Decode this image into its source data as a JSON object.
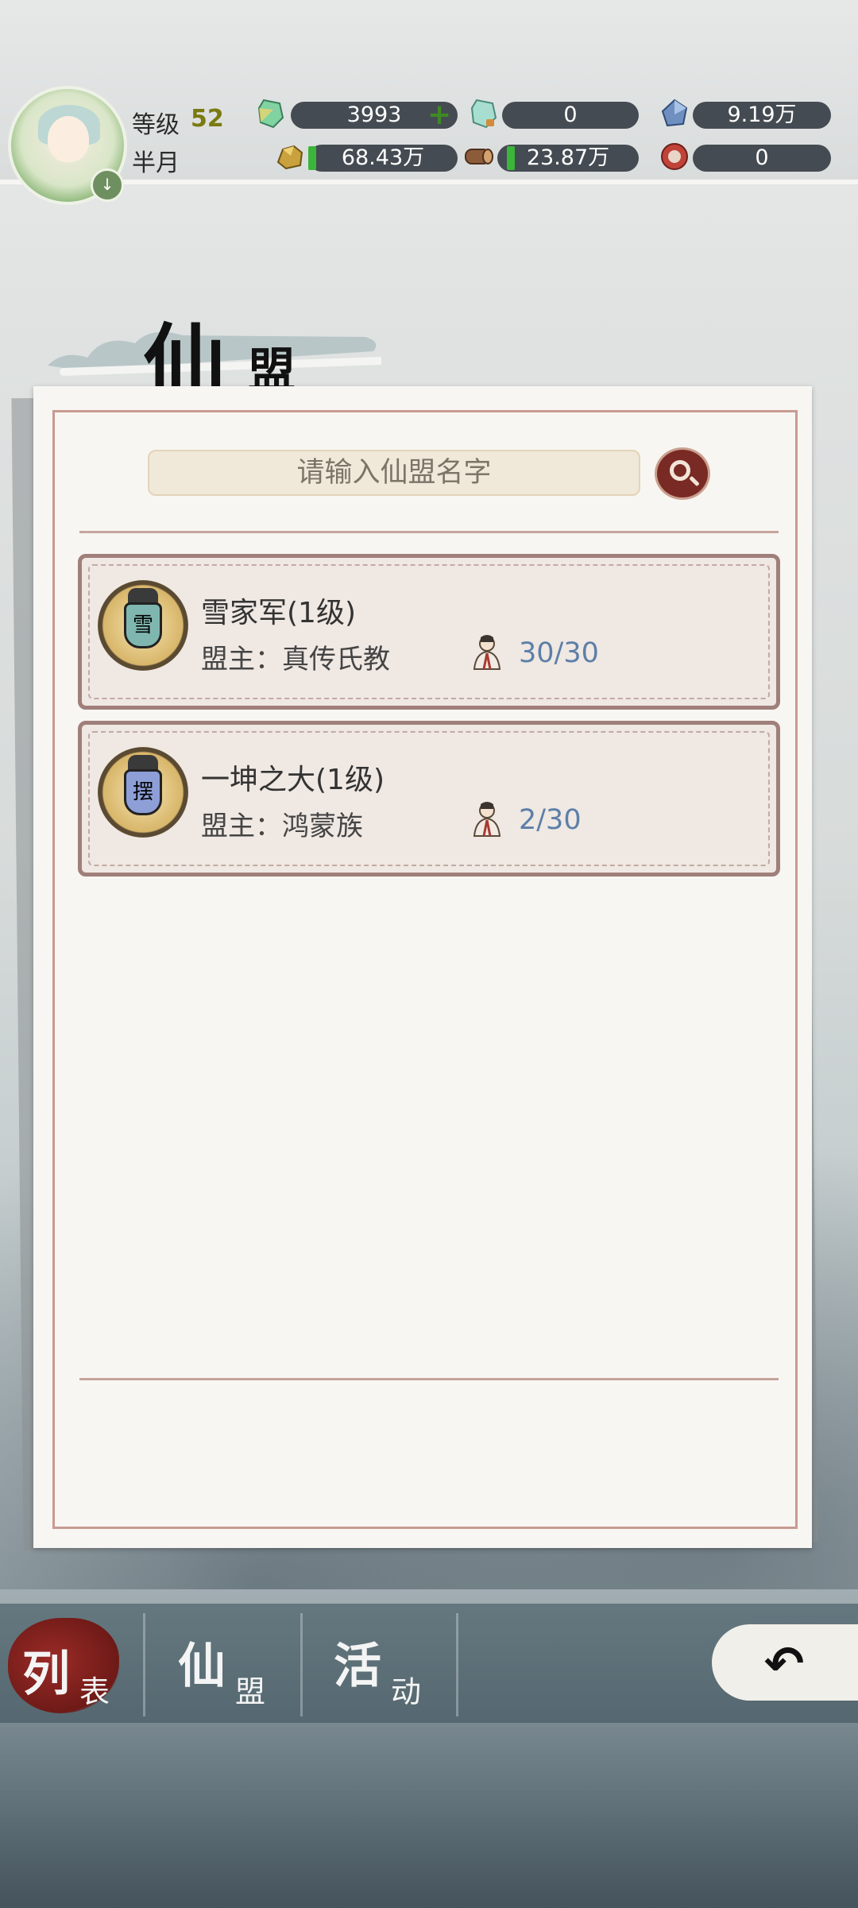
{
  "hud": {
    "level_label": "等级",
    "level_value": "52",
    "player_name": "半月",
    "avatar_badge": "↓",
    "resources": [
      {
        "name": "spirit-stone",
        "value": "3993",
        "has_plus": true
      },
      {
        "name": "bound-spirit-stone",
        "value": "0"
      },
      {
        "name": "blue-crystal",
        "value": "9.19万"
      },
      {
        "name": "gold-ore",
        "value": "68.43万"
      },
      {
        "name": "wood",
        "value": "23.87万"
      },
      {
        "name": "red-token",
        "value": "0"
      }
    ],
    "colors": {
      "bar": "#454b52",
      "plus": "#3e8a24"
    }
  },
  "page": {
    "title_big": "仙",
    "title_small": "盟"
  },
  "search": {
    "placeholder": "请输入仙盟名字",
    "icon": "search-icon"
  },
  "alliances": [
    {
      "name": "雪家军(1级)",
      "leader": "盟主：真传氏教",
      "members": "30/30",
      "emblem_char": "雪",
      "emblem_color": "#7fb7b0"
    },
    {
      "name": "一坤之大(1级)",
      "leader": "盟主：鸿蒙族",
      "members": "2/30",
      "emblem_char": "摆",
      "emblem_color": "#8e9fd8"
    }
  ],
  "tabs": [
    {
      "big": "列",
      "small": "表",
      "active": true
    },
    {
      "big": "仙",
      "small": "盟",
      "active": false
    },
    {
      "big": "活",
      "small": "动",
      "active": false
    }
  ],
  "back": {
    "icon": "back-arrow-icon",
    "glyph": "↶"
  }
}
